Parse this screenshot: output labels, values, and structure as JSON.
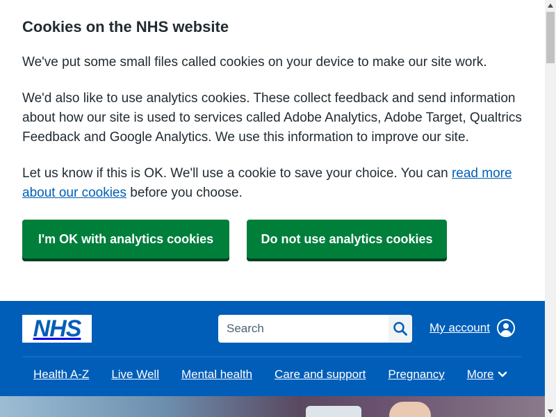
{
  "cookie_banner": {
    "title": "Cookies on the NHS website",
    "para1": "We've put some small files called cookies on your device to make our site work.",
    "para2": "We'd also like to use analytics cookies. These collect feedback and send information about how our site is used to services called Adobe Analytics, Adobe Target, Qualtrics Feedback and Google Analytics. We use this information to improve our site.",
    "para3_before": "Let us know if this is OK. We'll use a cookie to save your choice. You can ",
    "para3_link": "read more about our cookies",
    "para3_after": " before you choose.",
    "accept_label": "I'm OK with analytics cookies",
    "reject_label": "Do not use analytics cookies"
  },
  "header": {
    "logo_text": "NHS",
    "search_placeholder": "Search",
    "account_label": "My account",
    "nav": [
      "Health A-Z",
      "Live Well",
      "Mental health",
      "Care and support",
      "Pregnancy"
    ],
    "more_label": "More"
  },
  "icons": {
    "search": "search-icon",
    "account": "user-circle-icon",
    "more": "chevron-down-icon"
  },
  "colors": {
    "nhs_blue": "#005eb8",
    "button_green": "#007f3b",
    "button_shadow": "#00401e",
    "text": "#212b32",
    "link": "#005eb8"
  }
}
